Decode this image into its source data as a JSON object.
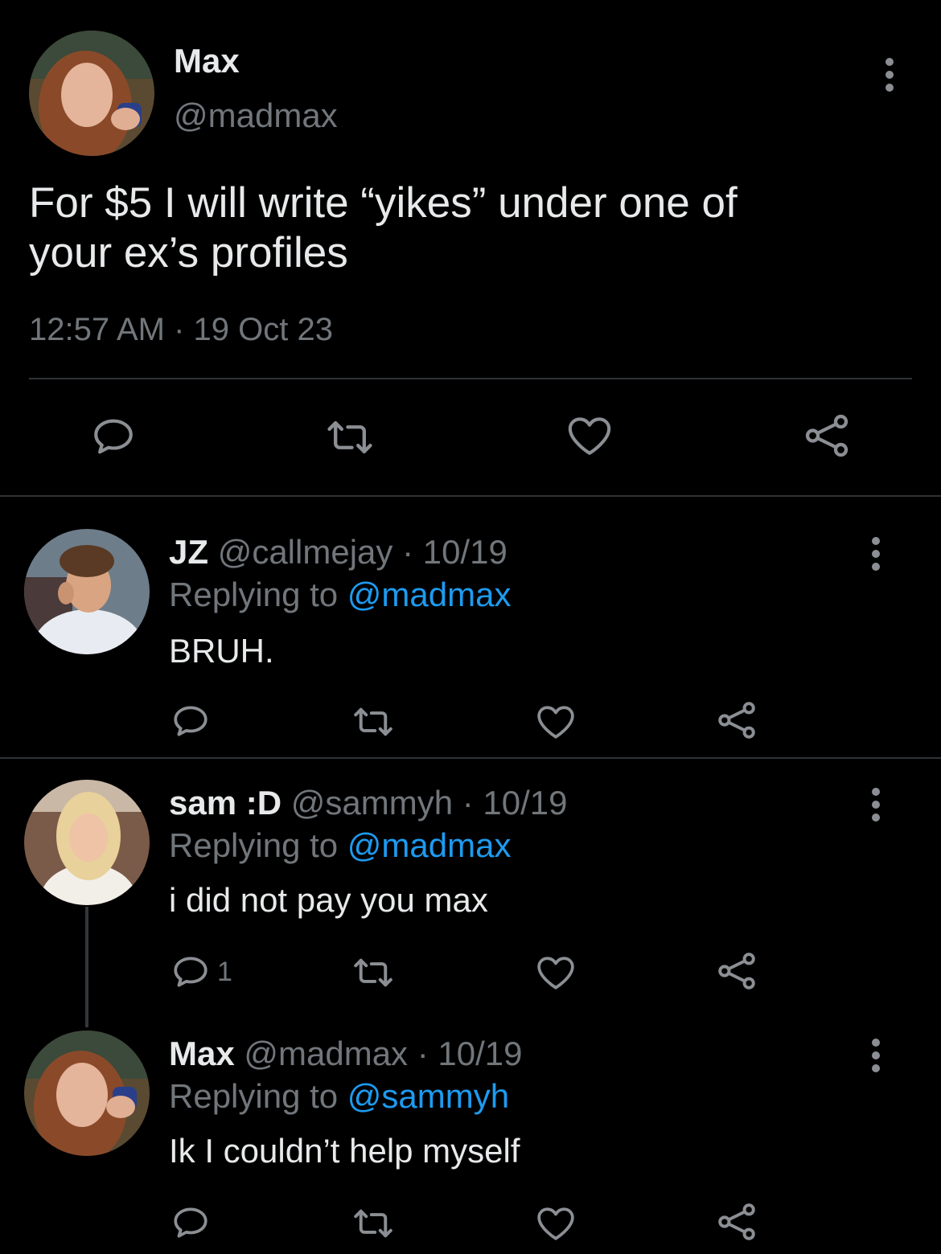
{
  "colors": {
    "background": "#000000",
    "text": "#e7e9ea",
    "muted": "#71767b",
    "accent": "#1d9bf0"
  },
  "main_tweet": {
    "author_name": "Max",
    "handle": "@madmax",
    "text_line1": "For $5 I will write “yikes” under one of",
    "text_line2": "your ex’s profiles",
    "timestamp": "12:57 AM · 19 Oct 23",
    "actions": {
      "reply_icon": "reply-icon",
      "retweet_icon": "retweet-icon",
      "like_icon": "heart-icon",
      "share_icon": "share-icon"
    }
  },
  "replies": [
    {
      "name": "JZ",
      "handle": "@callmejay",
      "date": "· 10/19",
      "replying_prefix": "Replying to",
      "replying_to": "@madmax",
      "text": "BRUH.",
      "reply_count": ""
    },
    {
      "name": "sam :D",
      "handle": "@sammyh",
      "date": "· 10/19",
      "replying_prefix": "Replying to",
      "replying_to": "@madmax",
      "text": "i did not pay you max",
      "reply_count": "1"
    },
    {
      "name": "Max",
      "handle": "@madmax",
      "date": "· 10/19",
      "replying_prefix": "Replying to",
      "replying_to": "@sammyh",
      "text": "Ik I couldn’t help myself",
      "reply_count": ""
    }
  ]
}
